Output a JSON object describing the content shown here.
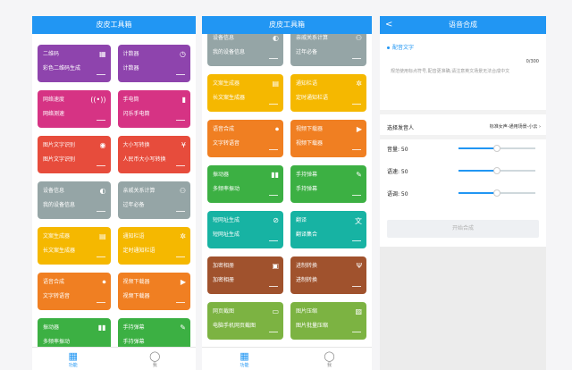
{
  "colors": {
    "appbar": "#2196F3",
    "purple": "#8E44AD",
    "magenta": "#D63384",
    "orange": "#F07F22",
    "red": "#E74C3C",
    "gray": "#95A5A6",
    "yellow": "#F5B800",
    "green": "#3CB043",
    "teal": "#17B3A3",
    "brown": "#A0522D",
    "lime": "#7CB342"
  },
  "screen1": {
    "title": "皮皮工具箱",
    "cards": [
      {
        "t1": "二维码",
        "t2": "彩色二维码生成",
        "icon": "qr-icon",
        "glyph": "▦",
        "color": "#8E44AD"
      },
      {
        "t1": "计数器",
        "t2": "计数器",
        "icon": "timer-icon",
        "glyph": "◷",
        "color": "#8E44AD"
      },
      {
        "t1": "网络速度",
        "t2": "网络测速",
        "icon": "wifi-icon",
        "glyph": "((•))",
        "color": "#D63384"
      },
      {
        "t1": "手电筒",
        "t2": "闪乐手电筒",
        "icon": "flashlight-icon",
        "glyph": "▮",
        "color": "#D63384"
      },
      {
        "t1": "图片文字识别",
        "t2": "图片文字识别",
        "icon": "eye-icon",
        "glyph": "◉",
        "color": "#E74C3C"
      },
      {
        "t1": "大小写转换",
        "t2": "人民币大小写转换",
        "icon": "currency-icon",
        "glyph": "¥",
        "color": "#E74C3C"
      },
      {
        "t1": "设备信息",
        "t2": "我的设备信息",
        "icon": "info-icon",
        "glyph": "◐",
        "color": "#95A5A6"
      },
      {
        "t1": "亲戚关系计算",
        "t2": "过年必备",
        "icon": "people-icon",
        "glyph": "⚇",
        "color": "#95A5A6"
      },
      {
        "t1": "文案生成器",
        "t2": "长文案生成器",
        "icon": "doc-icon",
        "glyph": "▤",
        "color": "#F5B800"
      },
      {
        "t1": "通知栏语",
        "t2": "定时通知栏语",
        "icon": "settings-icon",
        "glyph": "✲",
        "color": "#F5B800"
      },
      {
        "t1": "语音合成",
        "t2": "文字转语音",
        "icon": "mic-icon",
        "glyph": "⏺",
        "color": "#F07F22"
      },
      {
        "t1": "视频下载器",
        "t2": "视频下载器",
        "icon": "play-icon",
        "glyph": "▶",
        "color": "#F07F22"
      },
      {
        "t1": "振动器",
        "t2": "多频率振动",
        "icon": "bars-icon",
        "glyph": "▮▮",
        "color": "#3CB043"
      },
      {
        "t1": "手持弹幕",
        "t2": "手持弹幕",
        "icon": "pen-icon",
        "glyph": "✎",
        "color": "#3CB043"
      }
    ]
  },
  "screen2": {
    "title": "皮皮工具箱",
    "cards": [
      {
        "t1": "设备信息",
        "t2": "我的设备信息",
        "icon": "info-icon",
        "glyph": "◐",
        "color": "#95A5A6"
      },
      {
        "t1": "亲戚关系计算",
        "t2": "过年必备",
        "icon": "people-icon",
        "glyph": "⚇",
        "color": "#95A5A6"
      },
      {
        "t1": "文案生成器",
        "t2": "长文案生成器",
        "icon": "doc-icon",
        "glyph": "▤",
        "color": "#F5B800"
      },
      {
        "t1": "通知栏语",
        "t2": "定时通知栏语",
        "icon": "settings-icon",
        "glyph": "✲",
        "color": "#F5B800"
      },
      {
        "t1": "语音合成",
        "t2": "文字转语音",
        "icon": "mic-icon",
        "glyph": "⏺",
        "color": "#F07F22"
      },
      {
        "t1": "视频下载器",
        "t2": "视频下载器",
        "icon": "play-icon",
        "glyph": "▶",
        "color": "#F07F22"
      },
      {
        "t1": "振动器",
        "t2": "多频率振动",
        "icon": "bars-icon",
        "glyph": "▮▮",
        "color": "#3CB043"
      },
      {
        "t1": "手持弹幕",
        "t2": "手持弹幕",
        "icon": "pen-icon",
        "glyph": "✎",
        "color": "#3CB043"
      },
      {
        "t1": "短网址生成",
        "t2": "短网址生成",
        "icon": "link-icon",
        "glyph": "⊘",
        "color": "#17B3A3"
      },
      {
        "t1": "翻译",
        "t2": "翻译集合",
        "icon": "translate-icon",
        "glyph": "文",
        "color": "#17B3A3"
      },
      {
        "t1": "加密相册",
        "t2": "加密相册",
        "icon": "album-icon",
        "glyph": "▣",
        "color": "#A0522D"
      },
      {
        "t1": "进制转换",
        "t2": "进制转换",
        "icon": "fork-icon",
        "glyph": "Ψ",
        "color": "#A0522D"
      },
      {
        "t1": "网页截图",
        "t2": "电脑手机网页截图",
        "icon": "screenshot-icon",
        "glyph": "▭",
        "color": "#7CB342"
      },
      {
        "t1": "图片压缩",
        "t2": "图片批量压缩",
        "icon": "image-icon",
        "glyph": "▨",
        "color": "#7CB342"
      }
    ]
  },
  "nav": {
    "home_label": "功能",
    "me_label": "我",
    "home_glyph": "▦",
    "me_glyph": "◯"
  },
  "screen3": {
    "back_glyph": "<",
    "title": "语音合成",
    "section_label": "配音文字",
    "counter": "0/300",
    "placeholder": "规范使用标点符号,配音更准确,请注意英文场景无法合成中文",
    "voice_label": "选择发音人",
    "voice_value": "标准女声-通用场景-小云",
    "chevron_glyph": "›",
    "sliders": [
      {
        "label": "音量: 50",
        "value": 50
      },
      {
        "label": "语速: 50",
        "value": 50
      },
      {
        "label": "语调: 50",
        "value": 50
      }
    ],
    "start_button": "开始合成"
  }
}
